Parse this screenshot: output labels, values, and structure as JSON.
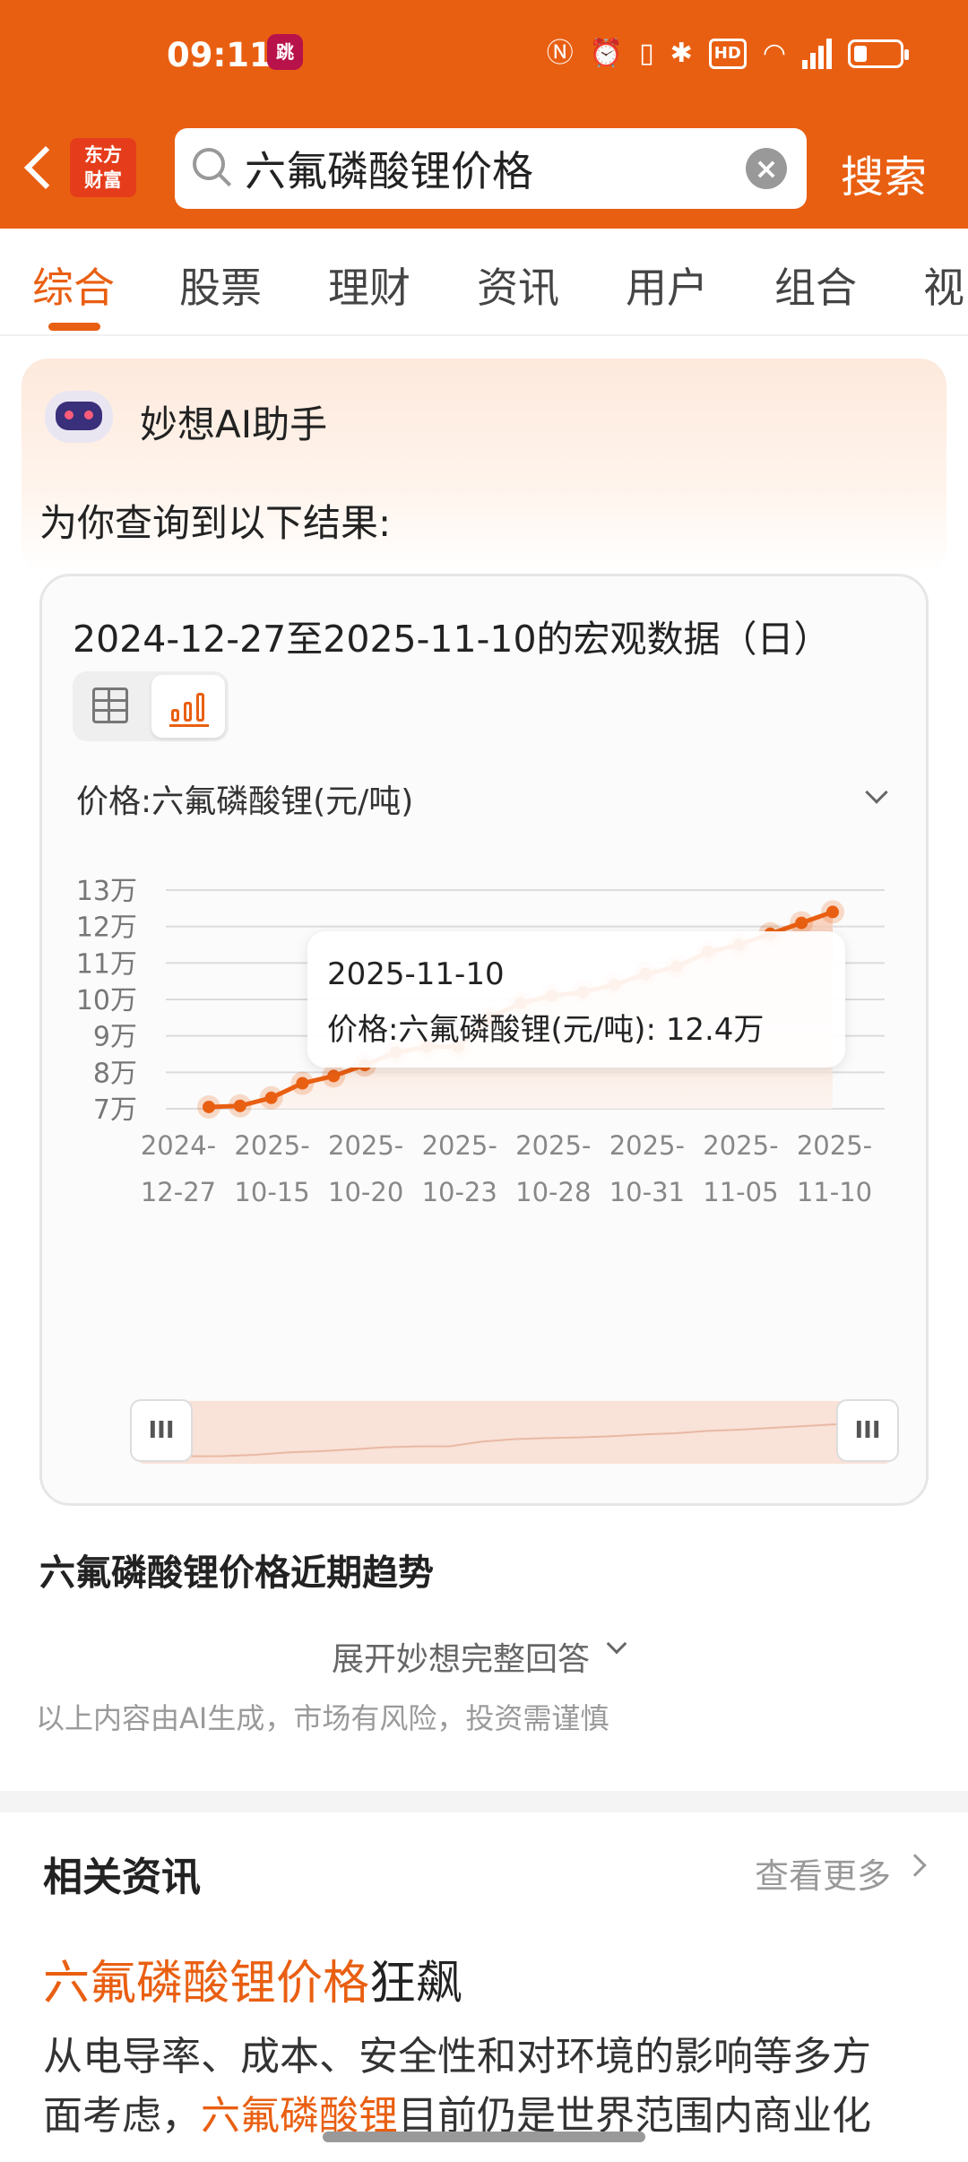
{
  "status": {
    "time": "09:11",
    "app_icon_text": "跳"
  },
  "header": {
    "logo_line1": "东方",
    "logo_line2": "财富",
    "search_value": "六氟磷酸锂价格",
    "search_button": "搜索"
  },
  "tabs": [
    "综合",
    "股票",
    "理财",
    "资讯",
    "用户",
    "组合",
    "视"
  ],
  "ai": {
    "title": "妙想AI助手",
    "subtitle": "为你查询到以下结果:"
  },
  "panel": {
    "title": "2024-12-27至2025-11-10的宏观数据（日）",
    "indicator": "价格:六氟磷酸锂(元/吨)",
    "tooltip_date": "2025-11-10",
    "tooltip_value": "价格:六氟磷酸锂(元/吨):  12.4万"
  },
  "chart_data": {
    "type": "line",
    "title": "",
    "xlabel": "",
    "ylabel": "",
    "y_tick_labels": [
      "7万",
      "8万",
      "9万",
      "10万",
      "11万",
      "12万",
      "13万"
    ],
    "ylim": [
      70000,
      130000
    ],
    "x_tick_labels": [
      [
        "2024-",
        "12-27"
      ],
      [
        "2025-",
        "10-15"
      ],
      [
        "2025-",
        "10-20"
      ],
      [
        "2025-",
        "10-23"
      ],
      [
        "2025-",
        "10-28"
      ],
      [
        "2025-",
        "10-31"
      ],
      [
        "2025-",
        "11-05"
      ],
      [
        "2025-",
        "11-10"
      ]
    ],
    "grid": true,
    "series": [
      {
        "values": [
          70500,
          70800,
          73000,
          77000,
          79000,
          82000,
          85500,
          87000,
          87000,
          95000,
          99000,
          101000,
          102000,
          104000,
          107000,
          109000,
          113000,
          115000,
          118000,
          121000,
          124000
        ]
      }
    ],
    "color": "#e95f12"
  },
  "trend_title": "六氟磷酸锂价格近期趋势",
  "expand_label": "展开妙想完整回答",
  "disclaimer": "以上内容由AI生成，市场有风险，投资需谨慎",
  "news": {
    "header": "相关资讯",
    "more": "查看更多",
    "title_highlight": "六氟磷酸锂价格",
    "title_rest": "狂飙",
    "body_line1": "从电导率、成本、安全性和对环境的影响等多方",
    "body_line2_pre": "面考虑，",
    "body_line2_hl": "六氟磷酸锂",
    "body_line2_post": "目前仍是世界范围内商业化"
  },
  "colors": {
    "accent": "#e95f12",
    "background": "#ffffff"
  }
}
